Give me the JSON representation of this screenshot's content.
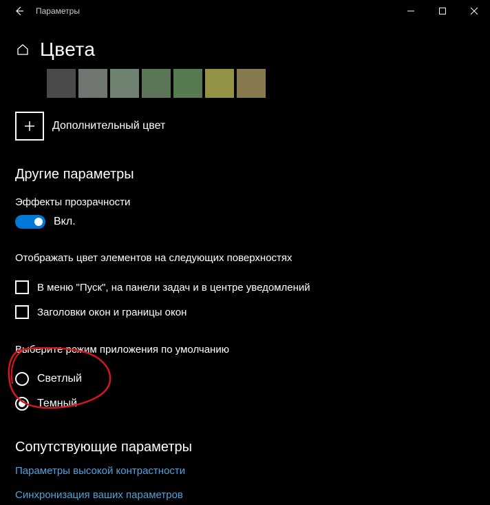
{
  "window": {
    "title": "Параметры"
  },
  "page": {
    "heading": "Цвета"
  },
  "swatches": [
    "#6b6b6b",
    "#4a4a4a",
    "#6f7770",
    "#6f8270",
    "#5b7557",
    "#577a52",
    "#929144",
    "#877a4e"
  ],
  "custom_color": {
    "label": "Дополнительный цвет"
  },
  "other_params": {
    "heading": "Другие параметры",
    "transparency": {
      "label": "Эффекты прозрачности",
      "state_label": "Вкл.",
      "on": true
    },
    "accent_surfaces": {
      "label": "Отображать цвет элементов на следующих поверхностях",
      "options": [
        {
          "label": "В меню \"Пуск\", на панели задач и в центре уведомлений",
          "checked": false
        },
        {
          "label": "Заголовки окон и границы окон",
          "checked": false
        }
      ]
    },
    "app_mode": {
      "label": "Выберите режим приложения по умолчанию",
      "options": [
        {
          "label": "Светлый",
          "selected": false
        },
        {
          "label": "Темный",
          "selected": true
        }
      ]
    }
  },
  "related": {
    "heading": "Сопутствующие параметры",
    "links": [
      "Параметры высокой контрастности",
      "Синхронизация ваших параметров"
    ]
  }
}
